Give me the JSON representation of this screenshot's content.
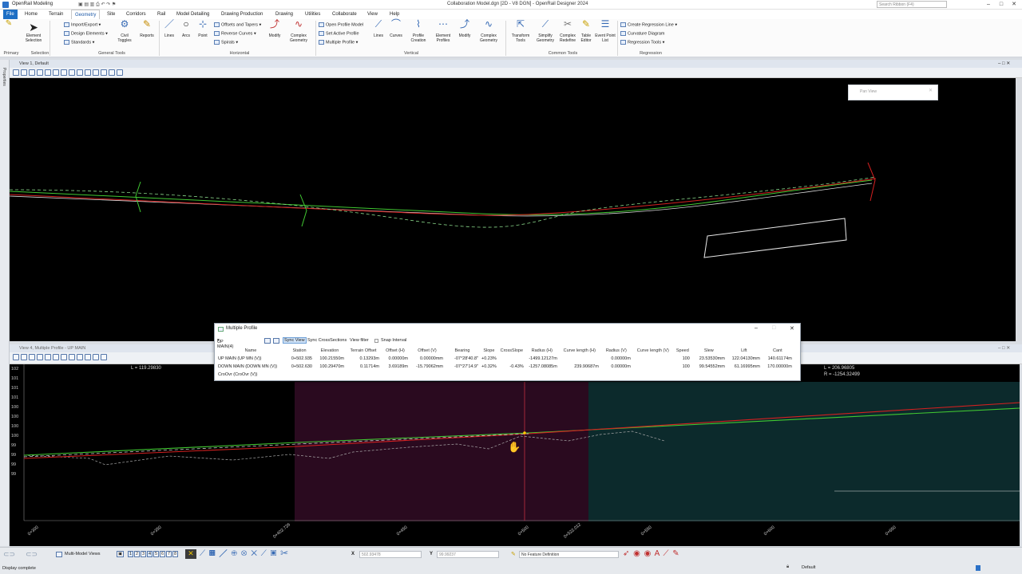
{
  "titlebar": {
    "workspace": "OpenRail Modeling",
    "title": "Collaboration Model.dgn [2D - V8 DGN] - OpenRail Designer 2024",
    "search_placeholder": "Search Ribbon (F4)"
  },
  "tabs": [
    "File",
    "Home",
    "Terrain",
    "Geometry",
    "Site",
    "Corridors",
    "Rail",
    "Model Detailing",
    "Drawing Production",
    "Drawing",
    "Utilities",
    "Collaborate",
    "View",
    "Help"
  ],
  "ribbon": {
    "element_selection": "Element Selection",
    "import_export": "Import/Export",
    "design_elements": "Design Elements",
    "standards": "Standards",
    "civil_toggles": "Civil Toggles",
    "reports": "Reports",
    "lines": "Lines",
    "arcs": "Arcs",
    "point": "Point",
    "offsets_tapers": "Offsets and Tapers",
    "reverse_curves": "Reverse Curves",
    "spirals": "Spirals",
    "modify": "Modify",
    "complex_geometry": "Complex Geometry",
    "open_profile_model": "Open Profile Model",
    "set_active_profile": "Set Active Profile",
    "multiple_profile": "Multiple Profile",
    "v_lines": "Lines",
    "v_curves": "Curves",
    "profile_creation": "Profile Creation",
    "element_profiles": "Element Profiles",
    "v_modify": "Modify",
    "v_complex_geometry": "Complex Geometry",
    "transform_tools": "Transform Tools",
    "simplify_geometry": "Simplify Geometry",
    "complex_redefine": "Complex Redefine",
    "table_editor": "Table Editor",
    "event_point_list": "Event Point List",
    "create_regression_line": "Create Regression Line",
    "curvature_diagram": "Curvature Diagram",
    "regression_tools": "Regression Tools",
    "groups": {
      "primary": "Primary",
      "selection": "Selection",
      "general_tools": "General Tools",
      "horizontal": "Horizontal",
      "vertical": "Vertical",
      "common_tools": "Common Tools",
      "regression": "Regression"
    }
  },
  "left_strip": "Properties",
  "view1": {
    "title": "View 1, Default",
    "pan_view": "Pan View"
  },
  "view2": {
    "title": "View 4, Multiple Profile - UP MAIN",
    "readout_left": "L = 119.29830",
    "readout_right_l": "L = 206.96805",
    "readout_right_r": "R = -1254.32499",
    "y_ticks": [
      "102",
      "101",
      "101",
      "101",
      "100",
      "100",
      "100",
      "100",
      "99",
      "99",
      "99",
      "99"
    ],
    "x_ticks": [
      "0+300",
      "0+350",
      "0+402.726",
      "0+450",
      "0+500",
      "0+522.012",
      "0+550",
      "0+600",
      "0+650"
    ]
  },
  "multiple_profile": {
    "title": "Multiple Profile",
    "active": "UP MAIN(4)",
    "sync_view": "Sync View",
    "sync_cross": "Sync CrossSections",
    "view_filter": "View filter",
    "snap_interval": "Snap Interval",
    "columns": [
      "Name",
      "Station",
      "Elevation",
      "Terrain Offset",
      "Offset (H)",
      "Offset (V)",
      "Bearing",
      "Slope",
      "CrossSlope",
      "Radius (H)",
      "Curve length (H)",
      "Radius (V)",
      "Curve length (V)",
      "Speed",
      "Slew",
      "Lift",
      "Cant"
    ],
    "rows": [
      [
        "UP MAIN (UP MN (V))",
        "0+502.935",
        "100.21550m",
        "0.13293m",
        "0.00000m",
        "0.00000mm",
        "-07°28'40.8\"",
        "+0.23%",
        "",
        "-1499.12127m",
        "",
        "0.00000m",
        "",
        "100",
        "23.53530mm",
        "122.04130mm",
        "140.61174m"
      ],
      [
        "DOWN MAIN (DOWN MN (V))",
        "0+502.630",
        "100.29470m",
        "0.11714m",
        "3.69189m",
        "-15.79062mm",
        "-07°27'14.9\"",
        "+0.32%",
        "-0.43%",
        "-1257.08085m",
        "239.90687m",
        "0.00000m",
        "",
        "100",
        "99.54552mm",
        "61.16995mm",
        "170.00000m"
      ],
      [
        "CroOvr (CroOvr (V))",
        "",
        "",
        "",
        "",
        "",
        "",
        "",
        "",
        "",
        "",
        "",
        "",
        "",
        "",
        "",
        ""
      ]
    ]
  },
  "statusbar": {
    "views_label": "Multi-Model Views",
    "x_label": "X",
    "x_value": "502.93478",
    "y_label": "Y",
    "y_value": "99.99237",
    "feature_def": "No Feature Definition",
    "status_text": "Display complete",
    "level": "Default",
    "view_numbers": [
      "1",
      "2",
      "3",
      "4",
      "5",
      "6",
      "7",
      "8"
    ]
  },
  "colors": {
    "file_tab": "#1e6fc4",
    "profile_green": "#41c832",
    "profile_red": "#d42020",
    "highlight_purple": "#2a0a1f",
    "highlight_teal": "#0c2a2c"
  }
}
